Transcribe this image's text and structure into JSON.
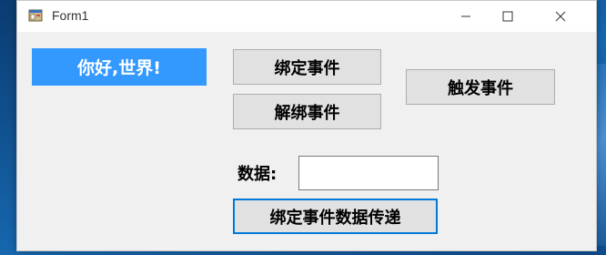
{
  "window": {
    "title": "Form1",
    "app_icon": "winforms-form-icon",
    "controls": {
      "minimize_icon": "minimize-icon",
      "maximize_icon": "maximize-icon",
      "close_icon": "close-icon"
    }
  },
  "form": {
    "hello_label": "你好,世界!",
    "bind_button": "绑定事件",
    "unbind_button": "解绑事件",
    "fire_button": "触发事件",
    "data_label": "数据:",
    "data_input": {
      "value": "",
      "placeholder": ""
    },
    "pass_button": "绑定事件数据传递"
  },
  "colors": {
    "label_background": "#3399ff",
    "label_text": "#ffffff",
    "button_background": "#e1e1e1",
    "focused_button_border": "#0078d7",
    "form_background": "#f0f0f0"
  }
}
